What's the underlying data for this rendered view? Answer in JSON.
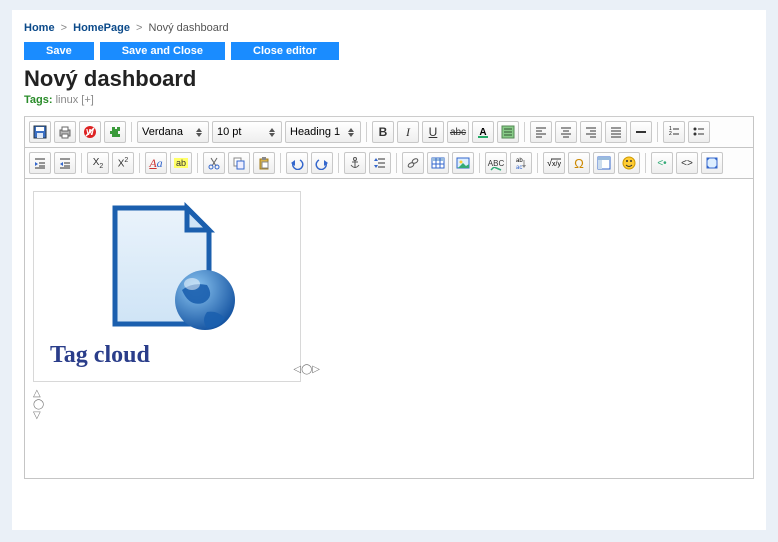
{
  "breadcrumb": {
    "home": "Home",
    "homepage": "HomePage",
    "current": "Nový dashboard"
  },
  "actions": {
    "save": "Save",
    "save_close": "Save and Close",
    "close": "Close editor"
  },
  "title": "Nový dashboard",
  "tags": {
    "label": "Tags:",
    "value": "linux",
    "add": "[+]"
  },
  "toolbar": {
    "font_family": "Verdana",
    "font_size": "10 pt",
    "block_format": "Heading 1"
  },
  "widget": {
    "label": "Tag cloud"
  }
}
